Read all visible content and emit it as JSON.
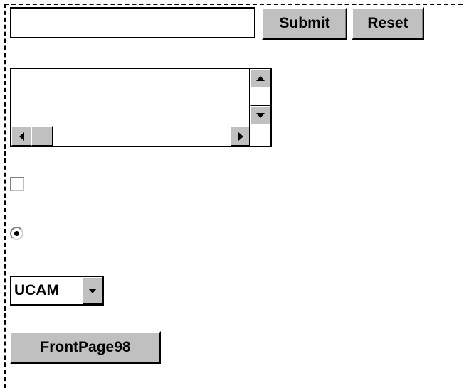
{
  "form": {
    "text_field": {
      "value": "",
      "placeholder": ""
    },
    "submit_label": "Submit",
    "reset_label": "Reset",
    "textarea": {
      "value": ""
    },
    "checkbox": {
      "checked": false
    },
    "radio": {
      "checked": true
    },
    "dropdown": {
      "selected": "UCAM"
    },
    "push_button_label": "FrontPage98"
  },
  "icons": {
    "scroll_up": "arrow-up-icon",
    "scroll_down": "arrow-down-icon",
    "scroll_left": "arrow-left-icon",
    "scroll_right": "arrow-right-icon",
    "dropdown": "chevron-down-icon"
  },
  "colors": {
    "button_face": "#c0c0c0",
    "background": "#ffffff",
    "border": "#000000"
  }
}
